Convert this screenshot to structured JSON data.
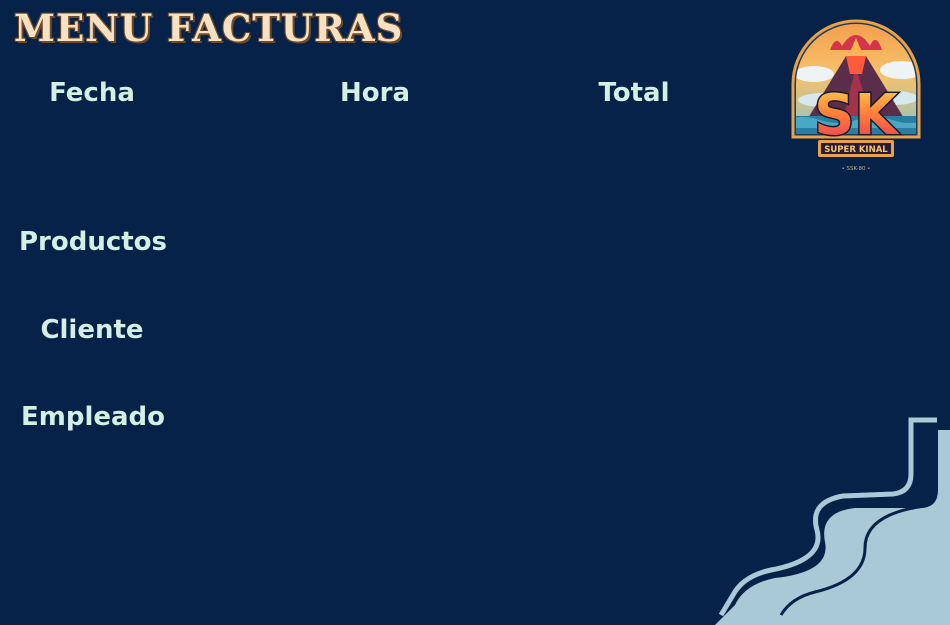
{
  "page": {
    "title": "MENU FACTURAS"
  },
  "columns": {
    "fecha": "Fecha",
    "hora": "Hora",
    "total": "Total"
  },
  "fields": {
    "productos": "Productos",
    "cliente": "Cliente",
    "empleado": "Empleado"
  },
  "logo": {
    "initials": "SK",
    "name": "SUPER KINAL",
    "subtext": "• SSK-80 •"
  },
  "colors": {
    "background": "#062249",
    "title": "#f6e2c2",
    "label": "#d4f0e4",
    "accent": "#a8c9d6"
  }
}
